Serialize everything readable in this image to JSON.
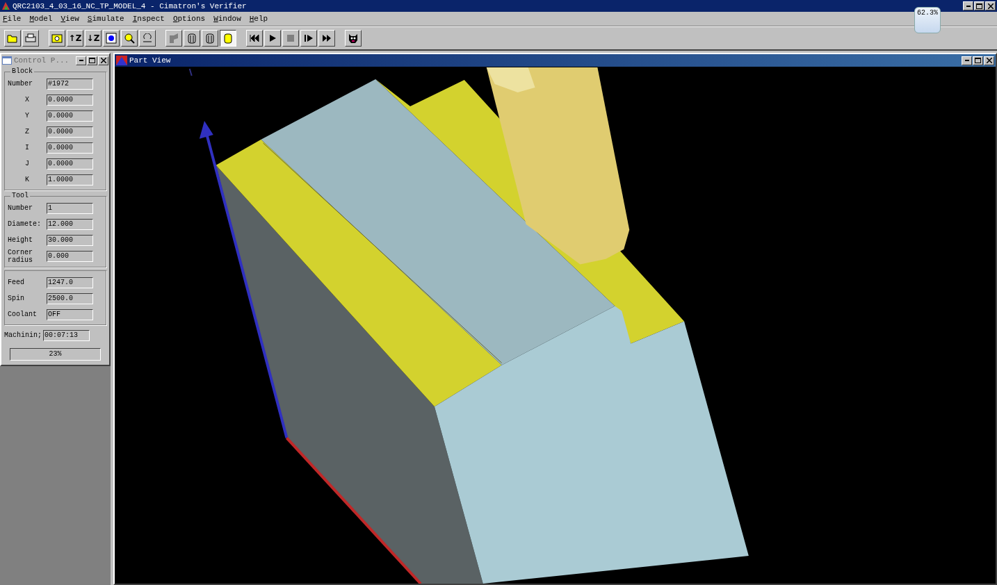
{
  "window": {
    "title": "QRC2103_4_03_16_NC_TP_MODEL_4 - Cimatron's Verifier"
  },
  "menu": [
    "File",
    "Model",
    "View",
    "Simulate",
    "Inspect",
    "Options",
    "Window",
    "Help"
  ],
  "toolbar": [
    [
      {
        "kind": "open",
        "selected": false
      },
      {
        "kind": "print",
        "selected": false
      }
    ],
    [
      {
        "kind": "camera",
        "selected": false
      },
      {
        "kind": "text",
        "label": "↑Z",
        "selected": false
      },
      {
        "kind": "text",
        "label": "↓Z",
        "selected": false
      },
      {
        "kind": "dot",
        "selected": false
      },
      {
        "kind": "magnify",
        "selected": false
      },
      {
        "kind": "undo",
        "selected": false
      }
    ],
    [
      {
        "kind": "mill",
        "selected": false
      },
      {
        "kind": "cylinder",
        "selected": false
      },
      {
        "kind": "cylinder",
        "selected": false
      },
      {
        "kind": "solid",
        "selected": true
      }
    ],
    [
      {
        "kind": "rewind",
        "selected": false
      },
      {
        "kind": "play",
        "selected": false
      },
      {
        "kind": "stop",
        "selected": false
      },
      {
        "kind": "step",
        "selected": false
      },
      {
        "kind": "forward",
        "selected": false
      }
    ],
    [
      {
        "kind": "mascot",
        "selected": false
      }
    ]
  ],
  "memory_badge": "62.3%",
  "control_panel": {
    "title": "Control P...",
    "groups": [
      {
        "title": "Block",
        "fields": [
          {
            "label": "Number",
            "value": "#1972"
          },
          {
            "label": "X",
            "value": "0.0000"
          },
          {
            "label": "Y",
            "value": "0.0000"
          },
          {
            "label": "Z",
            "value": "0.0000"
          },
          {
            "label": "I",
            "value": "0.0000"
          },
          {
            "label": "J",
            "value": "0.0000"
          },
          {
            "label": "K",
            "value": "1.0000"
          }
        ]
      },
      {
        "title": "Tool",
        "fields": [
          {
            "label": "Number",
            "value": "1"
          },
          {
            "label": "Diamete:",
            "value": "12.000"
          },
          {
            "label": "Height",
            "value": "30.000"
          },
          {
            "label": "Corner radius",
            "value": "0.000"
          }
        ]
      },
      {
        "fields": [
          {
            "label": "Feed",
            "value": "1247.0"
          },
          {
            "label": "Spin",
            "value": "2500.0"
          },
          {
            "label": "Coolant",
            "value": "OFF"
          }
        ]
      }
    ],
    "machining": {
      "label": "Machinin;",
      "value": "00:07:13"
    },
    "progress": "23%"
  },
  "part_view": {
    "title": "Part View"
  }
}
